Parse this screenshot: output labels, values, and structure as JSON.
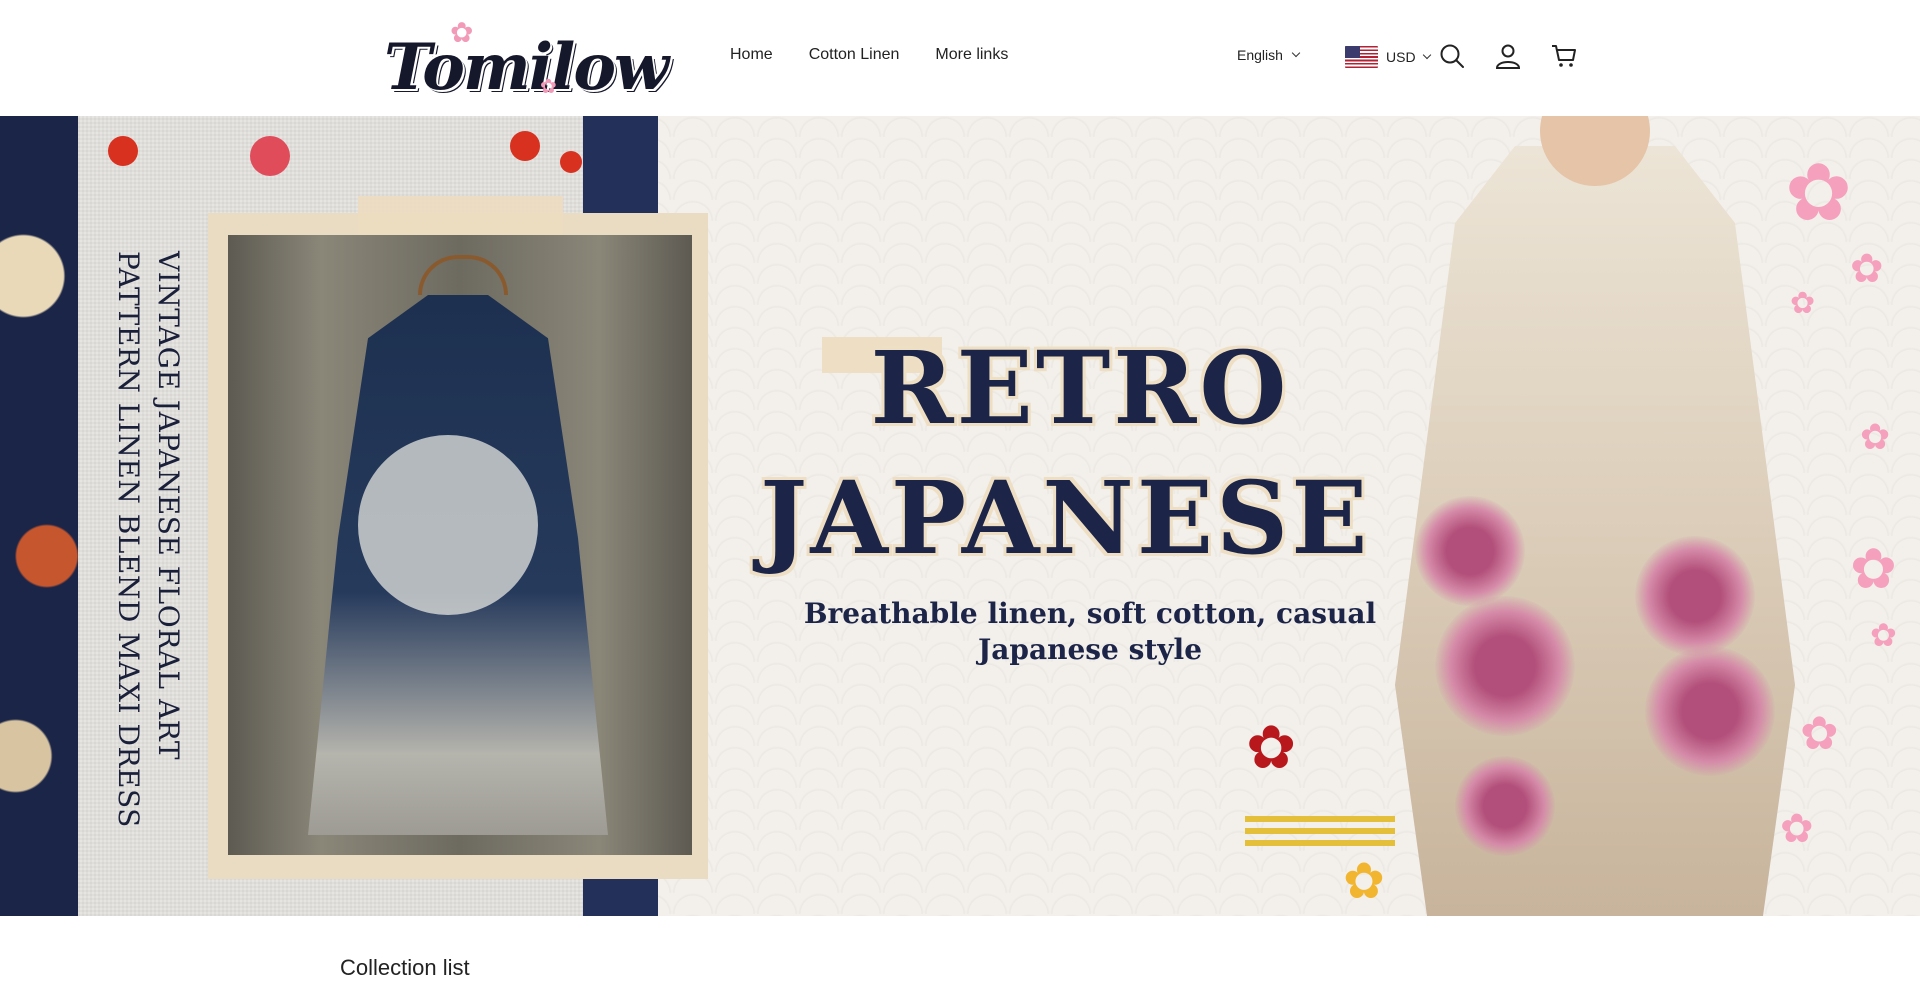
{
  "header": {
    "logo_text": "Tomilow",
    "nav": [
      {
        "label": "Home"
      },
      {
        "label": "Cotton Linen"
      },
      {
        "label": "More links"
      }
    ],
    "language": "English",
    "currency": "USD",
    "icons": [
      "search-icon",
      "account-icon",
      "cart-icon"
    ]
  },
  "hero": {
    "vertical_text": "VINTAGE JAPANESE FLORAL ART PATTERN LINEN BLEND MAXI DRESS",
    "title_line1": "RETRO",
    "title_line2": "JAPANESE",
    "subtitle": "Breathable linen, soft cotton, casual Japanese style"
  },
  "collection": {
    "title": "Collection list"
  },
  "colors": {
    "navy": "#1c2448",
    "cream": "#eedfc4",
    "background": "#f3f0ec"
  }
}
